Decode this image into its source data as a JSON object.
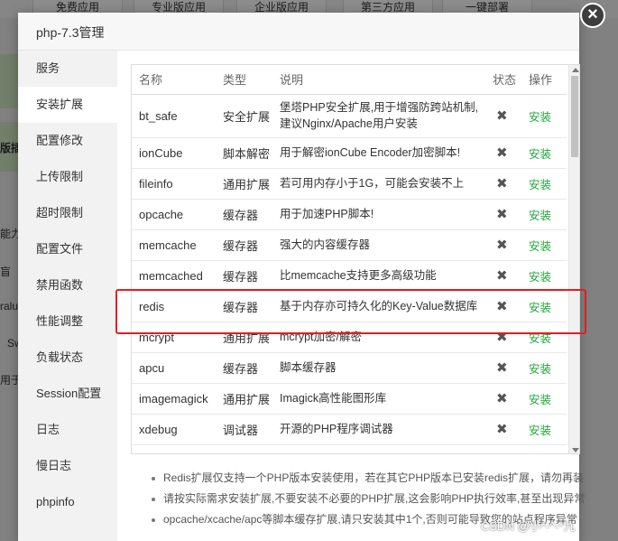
{
  "background": {
    "tabs": [
      "免费应用",
      "专业版应用",
      "企业版应用",
      "第三方应用",
      "一键部署"
    ],
    "fragments": [
      "版插",
      "能力",
      "盲",
      "ralu",
      "Sw",
      "用于"
    ]
  },
  "modal": {
    "title": "php-7.3管理",
    "close_icon": "close-icon"
  },
  "sidebar": {
    "items": [
      {
        "label": "服务"
      },
      {
        "label": "安装扩展"
      },
      {
        "label": "配置修改"
      },
      {
        "label": "上传限制"
      },
      {
        "label": "超时限制"
      },
      {
        "label": "配置文件"
      },
      {
        "label": "禁用函数"
      },
      {
        "label": "性能调整"
      },
      {
        "label": "负载状态"
      },
      {
        "label": "Session配置"
      },
      {
        "label": "日志"
      },
      {
        "label": "慢日志"
      },
      {
        "label": "phpinfo"
      }
    ],
    "active": 1
  },
  "table": {
    "headers": [
      "名称",
      "类型",
      "说明",
      "状态",
      "操作"
    ],
    "rows": [
      {
        "name": "bt_safe",
        "type": "安全扩展",
        "desc": "堡塔PHP安全扩展,用于增强防跨站机制,建议Nginx/Apache用户安装",
        "status": "✖",
        "op": "安装"
      },
      {
        "name": "ionCube",
        "type": "脚本解密",
        "desc": "用于解密ionCube Encoder加密脚本!",
        "status": "✖",
        "op": "安装"
      },
      {
        "name": "fileinfo",
        "type": "通用扩展",
        "desc": "若可用内存小于1G，可能会安装不上",
        "status": "✖",
        "op": "安装"
      },
      {
        "name": "opcache",
        "type": "缓存器",
        "desc": "用于加速PHP脚本!",
        "status": "✖",
        "op": "安装"
      },
      {
        "name": "memcache",
        "type": "缓存器",
        "desc": "强大的内容缓存器",
        "status": "✖",
        "op": "安装"
      },
      {
        "name": "memcached",
        "type": "缓存器",
        "desc": "比memcache支持更多高级功能",
        "status": "✖",
        "op": "安装"
      },
      {
        "name": "redis",
        "type": "缓存器",
        "desc": "基于内存亦可持久化的Key-Value数据库",
        "status": "✖",
        "op": "安装"
      },
      {
        "name": "mcrypt",
        "type": "通用扩展",
        "desc": "mcrypt加密/解密",
        "status": "✖",
        "op": "安装"
      },
      {
        "name": "apcu",
        "type": "缓存器",
        "desc": "脚本缓存器",
        "status": "✖",
        "op": "安装"
      },
      {
        "name": "imagemagick",
        "type": "通用扩展",
        "desc": "Imagick高性能图形库",
        "status": "✖",
        "op": "安装"
      },
      {
        "name": "xdebug",
        "type": "调试器",
        "desc": "开源的PHP程序调试器",
        "status": "✖",
        "op": "安装"
      }
    ]
  },
  "notes": [
    "Redis扩展仅支持一个PHP版本安装使用，若在其它PHP版本已安装redis扩展，请勿再装",
    "请按实际需求安装扩展,不要安装不必要的PHP扩展,这会影响PHP执行效率,甚至出现异常",
    "opcache/xcache/apc等脚本缓存扩展,请只安装其中1个,否则可能导致您的站点程序异常"
  ],
  "watermark": "CSDN @小*-^-*九",
  "colors": {
    "accent": "#20a53a",
    "highlight": "#e02020"
  }
}
